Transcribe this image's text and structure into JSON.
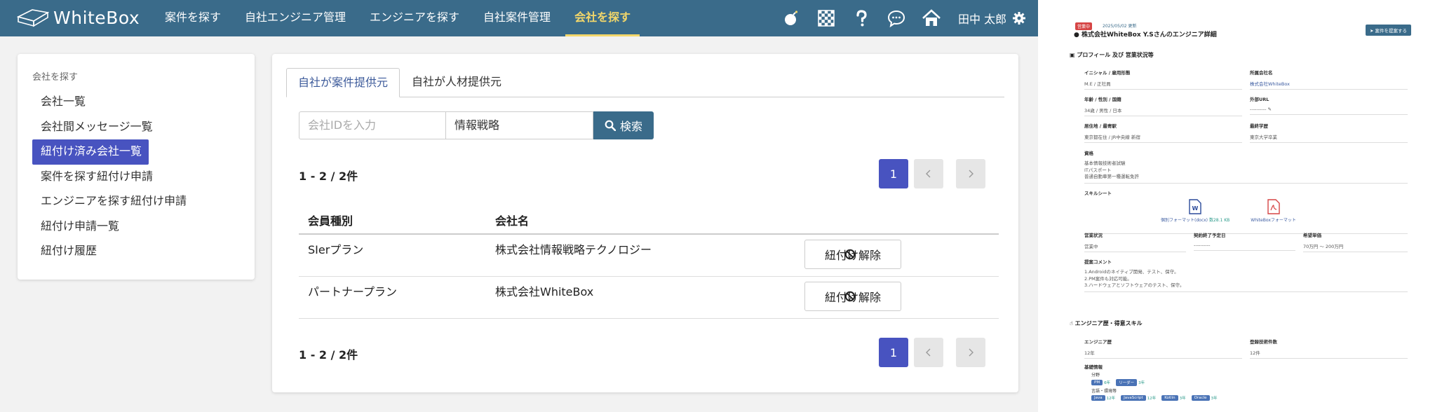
{
  "header": {
    "logo_text": "WhiteBox",
    "nav": [
      "案件を探す",
      "自社エンジニア管理",
      "エンジニアを探す",
      "自社案件管理",
      "会社を探す"
    ],
    "active_nav": "会社を探す",
    "icons": [
      "bomb-icon",
      "checker-icon",
      "question-icon",
      "chat-icon",
      "home-icon"
    ],
    "user_name": "田中 太郎"
  },
  "sidebar": {
    "heading": "会社を探す",
    "items": [
      "会社一覧",
      "会社間メッセージ一覧",
      "紐付け済み会社一覧",
      "案件を探す紐付け申請",
      "エンジニアを探す紐付け申請",
      "紐付け申請一覧",
      "紐付け履歴"
    ],
    "active_item": "紐付け済み会社一覧"
  },
  "main": {
    "tabs": [
      "自社が案件提供元",
      "自社が人材提供元"
    ],
    "active_tab": "自社が案件提供元",
    "search": {
      "id_placeholder": "会社IDを入力",
      "keyword_value": "情報戦略",
      "button_label": "検索"
    },
    "count_text": "1 - 2 / 2件",
    "pagination": {
      "current_page": "1"
    },
    "table": {
      "headers": [
        "会員種別",
        "会社名"
      ],
      "rows": [
        {
          "plan": "SIerプラン",
          "company": "株式会社情報戦略テクノロジー",
          "action": "紐付け解除"
        },
        {
          "plan": "パートナープラン",
          "company": "株式会社WhiteBox",
          "action": "紐付け解除"
        }
      ]
    }
  },
  "doc": {
    "status_badge": "営業中",
    "date": "2025/05/02 更新",
    "title": "株式会社WhiteBox Y.Sさんのエンジニア詳細",
    "propose_button": "案件を提案する",
    "section_profile": "プロフィール 及び 営業状況等",
    "fields": {
      "initial_label": "イニシャル / 雇用形態",
      "initial_value": "M.E / 正社員",
      "company_label": "所属会社名",
      "company_value": "株式会社WhiteBox",
      "age_label": "年齢 / 性別 / 国籍",
      "age_value": "34歳 / 男性 / 日本",
      "url_label": "外部URL",
      "url_value": "----------",
      "address_label": "居住地 / 最寄駅",
      "address_value": "東京都在住 / JR中央線 新宿",
      "edu_label": "最終学歴",
      "edu_value": "東京大学卒業",
      "cert_label": "資格",
      "cert_values": [
        "基本情報技術者試験",
        "ITパスポート",
        "普通自動車第一種運転免許"
      ],
      "skill_label": "スキルシート",
      "skill_word": "個別フォーマット(docx)",
      "skill_word_size": "数28.1 KB",
      "skill_pdf": "WhiteBoxフォーマット",
      "sales_label": "営業状況",
      "sales_value": "営業中",
      "contract_label": "契約終了予定日",
      "contract_value": "----------",
      "price_label": "希望単価",
      "price_value": "70万円 〜 200万円",
      "comment_label": "提案コメント",
      "comment_values": [
        "1.Androidのネイティブ開発、テスト、保守。",
        "2.PM案件も対応可能。",
        "3.ハードウェアとソフトウェアのテスト、保守。"
      ]
    },
    "section_skills": "エンジニア歴・得意スキル",
    "career_label": "エンジニア歴",
    "career_value": "12年",
    "projects_label": "登録技術件数",
    "projects_value": "12件",
    "basic_label": "基礎情報",
    "field_label": "分野",
    "field_tags": [
      {
        "name": "PM",
        "years": "6年"
      },
      {
        "name": "リーダー",
        "years": "3年"
      }
    ],
    "lang_label": "言語・環境等",
    "lang_tags": [
      {
        "name": "Java",
        "years": "12年"
      },
      {
        "name": "JavaScript",
        "years": "12年"
      },
      {
        "name": "Kotlin",
        "years": "3年"
      },
      {
        "name": "Oracle",
        "years": "3年"
      }
    ]
  }
}
